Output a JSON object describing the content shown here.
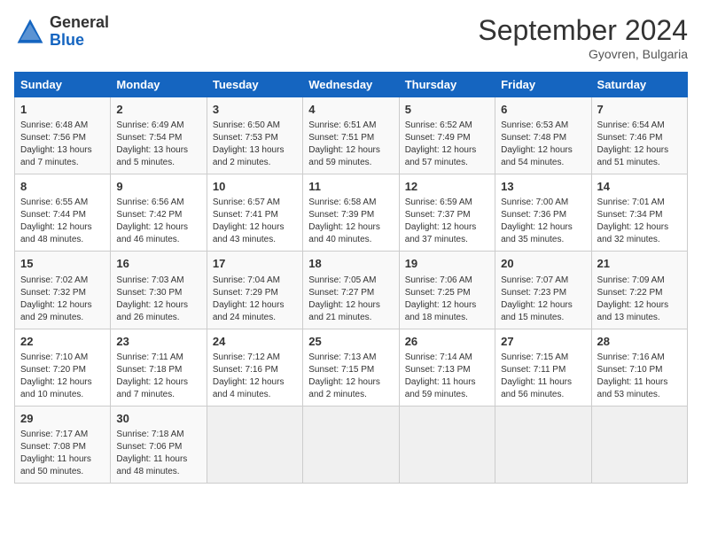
{
  "header": {
    "logo_line1": "General",
    "logo_line2": "Blue",
    "month_title": "September 2024",
    "subtitle": "Gyovren, Bulgaria"
  },
  "days_of_week": [
    "Sunday",
    "Monday",
    "Tuesday",
    "Wednesday",
    "Thursday",
    "Friday",
    "Saturday"
  ],
  "weeks": [
    [
      {
        "day": "1",
        "info": "Sunrise: 6:48 AM\nSunset: 7:56 PM\nDaylight: 13 hours\nand 7 minutes."
      },
      {
        "day": "2",
        "info": "Sunrise: 6:49 AM\nSunset: 7:54 PM\nDaylight: 13 hours\nand 5 minutes."
      },
      {
        "day": "3",
        "info": "Sunrise: 6:50 AM\nSunset: 7:53 PM\nDaylight: 13 hours\nand 2 minutes."
      },
      {
        "day": "4",
        "info": "Sunrise: 6:51 AM\nSunset: 7:51 PM\nDaylight: 12 hours\nand 59 minutes."
      },
      {
        "day": "5",
        "info": "Sunrise: 6:52 AM\nSunset: 7:49 PM\nDaylight: 12 hours\nand 57 minutes."
      },
      {
        "day": "6",
        "info": "Sunrise: 6:53 AM\nSunset: 7:48 PM\nDaylight: 12 hours\nand 54 minutes."
      },
      {
        "day": "7",
        "info": "Sunrise: 6:54 AM\nSunset: 7:46 PM\nDaylight: 12 hours\nand 51 minutes."
      }
    ],
    [
      {
        "day": "8",
        "info": "Sunrise: 6:55 AM\nSunset: 7:44 PM\nDaylight: 12 hours\nand 48 minutes."
      },
      {
        "day": "9",
        "info": "Sunrise: 6:56 AM\nSunset: 7:42 PM\nDaylight: 12 hours\nand 46 minutes."
      },
      {
        "day": "10",
        "info": "Sunrise: 6:57 AM\nSunset: 7:41 PM\nDaylight: 12 hours\nand 43 minutes."
      },
      {
        "day": "11",
        "info": "Sunrise: 6:58 AM\nSunset: 7:39 PM\nDaylight: 12 hours\nand 40 minutes."
      },
      {
        "day": "12",
        "info": "Sunrise: 6:59 AM\nSunset: 7:37 PM\nDaylight: 12 hours\nand 37 minutes."
      },
      {
        "day": "13",
        "info": "Sunrise: 7:00 AM\nSunset: 7:36 PM\nDaylight: 12 hours\nand 35 minutes."
      },
      {
        "day": "14",
        "info": "Sunrise: 7:01 AM\nSunset: 7:34 PM\nDaylight: 12 hours\nand 32 minutes."
      }
    ],
    [
      {
        "day": "15",
        "info": "Sunrise: 7:02 AM\nSunset: 7:32 PM\nDaylight: 12 hours\nand 29 minutes."
      },
      {
        "day": "16",
        "info": "Sunrise: 7:03 AM\nSunset: 7:30 PM\nDaylight: 12 hours\nand 26 minutes."
      },
      {
        "day": "17",
        "info": "Sunrise: 7:04 AM\nSunset: 7:29 PM\nDaylight: 12 hours\nand 24 minutes."
      },
      {
        "day": "18",
        "info": "Sunrise: 7:05 AM\nSunset: 7:27 PM\nDaylight: 12 hours\nand 21 minutes."
      },
      {
        "day": "19",
        "info": "Sunrise: 7:06 AM\nSunset: 7:25 PM\nDaylight: 12 hours\nand 18 minutes."
      },
      {
        "day": "20",
        "info": "Sunrise: 7:07 AM\nSunset: 7:23 PM\nDaylight: 12 hours\nand 15 minutes."
      },
      {
        "day": "21",
        "info": "Sunrise: 7:09 AM\nSunset: 7:22 PM\nDaylight: 12 hours\nand 13 minutes."
      }
    ],
    [
      {
        "day": "22",
        "info": "Sunrise: 7:10 AM\nSunset: 7:20 PM\nDaylight: 12 hours\nand 10 minutes."
      },
      {
        "day": "23",
        "info": "Sunrise: 7:11 AM\nSunset: 7:18 PM\nDaylight: 12 hours\nand 7 minutes."
      },
      {
        "day": "24",
        "info": "Sunrise: 7:12 AM\nSunset: 7:16 PM\nDaylight: 12 hours\nand 4 minutes."
      },
      {
        "day": "25",
        "info": "Sunrise: 7:13 AM\nSunset: 7:15 PM\nDaylight: 12 hours\nand 2 minutes."
      },
      {
        "day": "26",
        "info": "Sunrise: 7:14 AM\nSunset: 7:13 PM\nDaylight: 11 hours\nand 59 minutes."
      },
      {
        "day": "27",
        "info": "Sunrise: 7:15 AM\nSunset: 7:11 PM\nDaylight: 11 hours\nand 56 minutes."
      },
      {
        "day": "28",
        "info": "Sunrise: 7:16 AM\nSunset: 7:10 PM\nDaylight: 11 hours\nand 53 minutes."
      }
    ],
    [
      {
        "day": "29",
        "info": "Sunrise: 7:17 AM\nSunset: 7:08 PM\nDaylight: 11 hours\nand 50 minutes."
      },
      {
        "day": "30",
        "info": "Sunrise: 7:18 AM\nSunset: 7:06 PM\nDaylight: 11 hours\nand 48 minutes."
      },
      {
        "day": "",
        "info": ""
      },
      {
        "day": "",
        "info": ""
      },
      {
        "day": "",
        "info": ""
      },
      {
        "day": "",
        "info": ""
      },
      {
        "day": "",
        "info": ""
      }
    ]
  ]
}
